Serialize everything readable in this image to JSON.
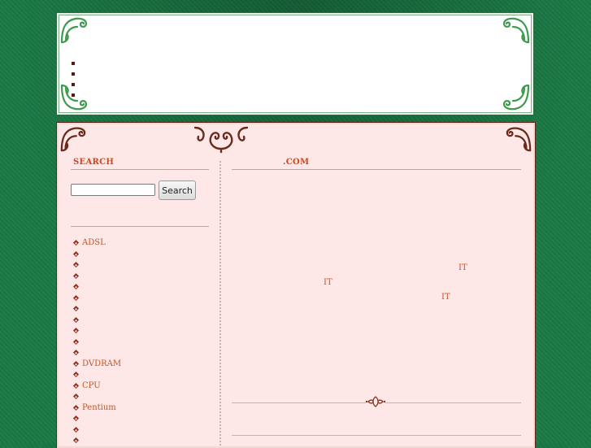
{
  "header": {
    "nav_items": [
      "",
      "",
      "",
      ""
    ]
  },
  "sidebar": {
    "search_heading": "SEARCH",
    "search_input_value": "",
    "search_button_label": "Search",
    "categories": [
      "ADSL",
      "",
      "",
      "",
      "",
      "",
      "",
      "",
      "",
      "",
      "",
      "DVDRAM",
      "",
      "CPU",
      "",
      "Pentium",
      "",
      "",
      ""
    ]
  },
  "main": {
    "title_suffix": ".COM",
    "it_links": [
      "IT",
      "IT",
      "IT"
    ]
  },
  "colors": {
    "page_background": "#1a7a45",
    "content_background": "#fde8e7",
    "accent_text": "#d0461c",
    "link_text": "#c0562a",
    "ornament_green": "#3f9a4e",
    "ornament_brown": "#6b2a1a"
  }
}
